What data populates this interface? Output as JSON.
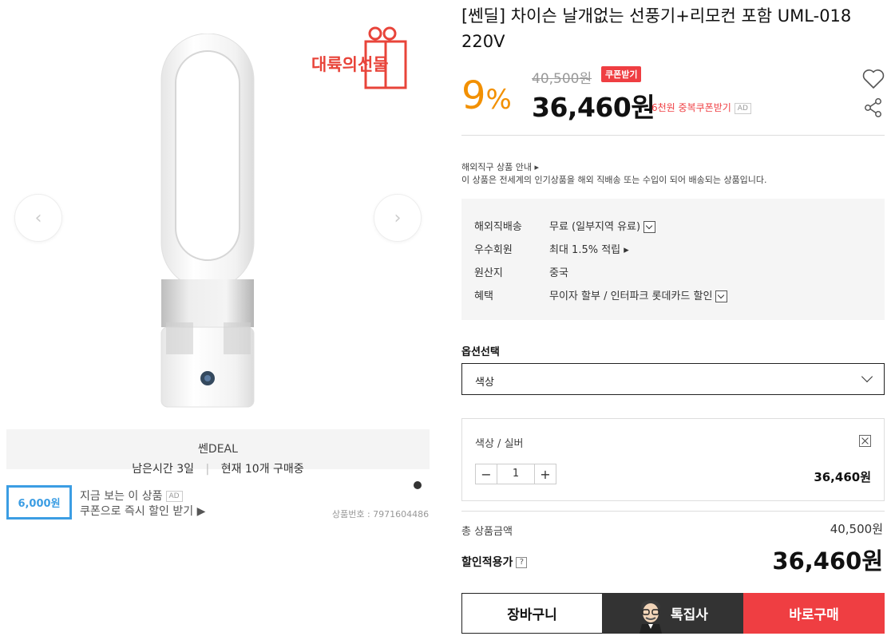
{
  "gallery": {
    "prev_arrow": "‹",
    "next_arrow": "›",
    "logo_text": "대륙의선물"
  },
  "deal": {
    "title": "쎈DEAL",
    "time_left": "남은시간 3일",
    "separator": "|",
    "buyers": "현재 10개 구매중"
  },
  "coupon_promo": {
    "amount": "6,000원",
    "line1": "지금 보는 이 상품",
    "ad": "AD",
    "line2": "쿠폰으로 즉시 할인 받기 ▶"
  },
  "product_number": "상품번호 : 7971604486",
  "product": {
    "title": "[쎈딜] 차이슨 날개없는 선풍기+리모컨 포함 UML-018 220V",
    "discount_pct": "9",
    "pct_sign": "%",
    "original_price": "40,500원",
    "coupon_button": "쿠폰받기",
    "price": "36,460원",
    "extra_coupon": "6천원 중복쿠폰받기",
    "ad": "AD"
  },
  "overseas": {
    "title": "해외직구 상품 안내 ▸",
    "desc": "이 상품은 전세계의 인기상품을 해외 직배송 또는 수입이 되어 배송되는 상품입니다."
  },
  "info": [
    {
      "key": "해외직배송",
      "value": "무료 (일부지역 유료)"
    },
    {
      "key": "우수회원",
      "value": "최대 1.5% 적립 ▸"
    },
    {
      "key": "원산지",
      "value": "중국"
    },
    {
      "key": "혜택",
      "value": "무이자 할부 / 인터파크 롯데카드 할인"
    }
  ],
  "option": {
    "label": "옵션선택",
    "selected": "색상"
  },
  "selection": {
    "name": "색상 / 실버",
    "minus": "−",
    "qty": "1",
    "plus": "+",
    "price": "36,460원"
  },
  "totals": {
    "total_label": "총 상품금액",
    "total_value": "40,500원",
    "discount_label": "할인적용가",
    "help": "?",
    "discount_value": "36,460원"
  },
  "actions": {
    "cart": "장바구니",
    "special": "톡집사",
    "buy": "바로구매"
  },
  "colors": {
    "accent_red": "#ef3e42",
    "discount_orange": "#f29000",
    "coupon_blue": "#3b9de3"
  }
}
